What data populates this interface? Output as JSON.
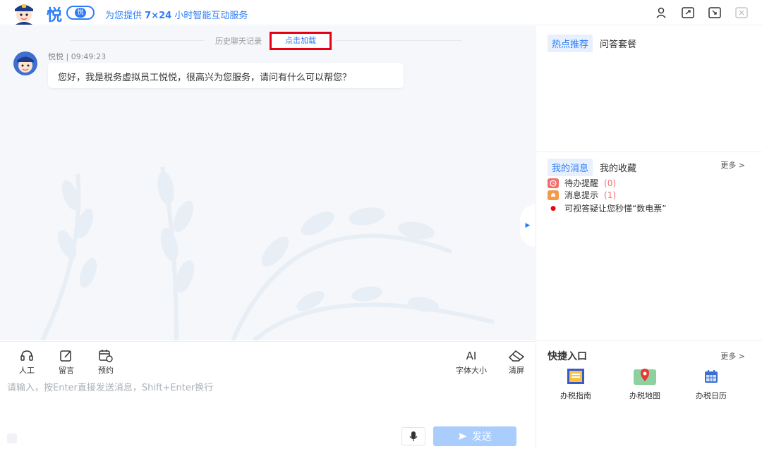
{
  "header": {
    "brand_char": "悦",
    "badge_char": "悦",
    "slogan_pre": "为您提供",
    "slogan_bold": "7×24",
    "slogan_post": "小时智能互动服务"
  },
  "chat": {
    "history_label": "历史聊天记录",
    "load_more_label": "点击加载",
    "message": {
      "sender": "悦悦",
      "time": "09:49:23",
      "text": "您好，我是税务虚拟员工悦悦，很高兴为您服务，请问有什么可以帮您？"
    }
  },
  "toolbar": {
    "left_tools": [
      "人工",
      "留言",
      "预约"
    ],
    "font_size_icon": "AI",
    "font_size_label": "字体大小",
    "clear_label": "清屏"
  },
  "input": {
    "placeholder": "请输入，按Enter直接发送消息，Shift+Enter换行",
    "send_label": "发送"
  },
  "right_panel": {
    "hot_tabs": [
      "热点推荐",
      "问答套餐"
    ],
    "msg_tabs": [
      "我的消息",
      "我的收藏"
    ],
    "more_label": "更多 >",
    "messages": [
      {
        "label": "待办提醒",
        "count": "(0)"
      },
      {
        "label": "消息提示",
        "count": "(1)"
      }
    ],
    "notice": "可视答疑让您秒懂“数电票”",
    "quick_title": "快捷入口",
    "quick_more": "更多 >",
    "quick_items": [
      "办税指南",
      "办税地图",
      "办税日历"
    ]
  },
  "colors": {
    "primary": "#2f7df6",
    "highlight_border": "#e60012",
    "send_disabled": "#a9cdfd",
    "alert": "#f56c6c"
  }
}
